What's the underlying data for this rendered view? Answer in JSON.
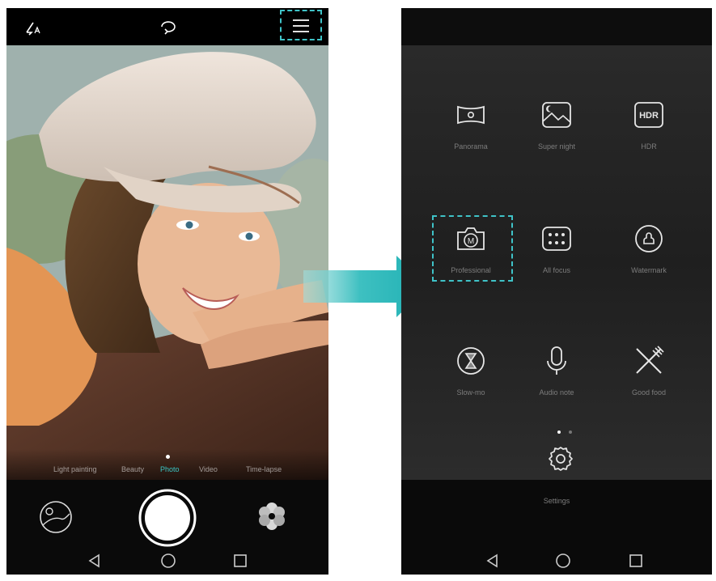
{
  "left_screen": {
    "top_bar": {
      "flash_icon": "flash-auto-icon",
      "switch_camera_icon": "switch-camera-icon",
      "menu_icon": "hamburger-menu-icon"
    },
    "mode_strip": {
      "modes": [
        "Light painting",
        "Beauty",
        "Photo",
        "Video",
        "Time-lapse"
      ],
      "selected": "Photo"
    },
    "bottom_bar": {
      "gallery_icon": "gallery-thumbnail-icon",
      "shutter_icon": "shutter-button",
      "filter_icon": "filter-flower-icon"
    },
    "nav": [
      "back-icon",
      "home-icon",
      "recents-icon"
    ]
  },
  "right_screen": {
    "modes": [
      {
        "label": "Panorama",
        "icon": "panorama-icon"
      },
      {
        "label": "Super night",
        "icon": "super-night-icon"
      },
      {
        "label": "HDR",
        "icon": "hdr-icon",
        "icon_text": "HDR"
      },
      {
        "label": "Professional",
        "icon": "professional-icon",
        "icon_text": "M"
      },
      {
        "label": "All focus",
        "icon": "all-focus-icon"
      },
      {
        "label": "Watermark",
        "icon": "watermark-icon"
      },
      {
        "label": "Slow-mo",
        "icon": "slow-mo-icon"
      },
      {
        "label": "Audio note",
        "icon": "audio-note-icon"
      },
      {
        "label": "Good food",
        "icon": "good-food-icon"
      }
    ],
    "page_indicator": {
      "pages": 2,
      "current": 1
    },
    "settings": {
      "label": "Settings",
      "icon": "settings-gear-icon"
    },
    "nav": [
      "back-icon",
      "home-icon",
      "recents-icon"
    ]
  },
  "colors": {
    "accent": "#3fc3c8",
    "arrow": "#2fb7b9",
    "label": "#7d7d7d"
  }
}
